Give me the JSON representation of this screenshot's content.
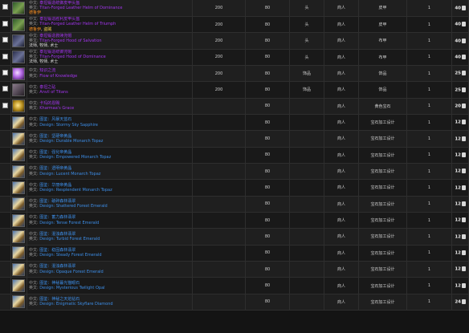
{
  "label_cn": "中文:",
  "label_en": "英文:",
  "items": [
    {
      "icon": "leather-helm-icon",
      "icon_class": "i-leather",
      "checkbox": true,
      "cn": "泰坦锻造统御皮甲头盔",
      "en": "Titan-Forged Leather Helm of Dominance",
      "classes": [
        {
          "text": "德鲁伊",
          "cls": "dk"
        }
      ],
      "ilvl": "200",
      "req": "80",
      "slot": "头",
      "source": "商人",
      "type": "皮甲",
      "qty": "1",
      "price": "40",
      "color": "purple"
    },
    {
      "icon": "leather-helm-icon",
      "icon_class": "i-leather",
      "checkbox": true,
      "cn": "泰坦锻造胜利皮甲头盔",
      "en": "Titan-Forged Leather Helm of Triumph",
      "classes": [
        {
          "text": "德鲁伊",
          "cls": "dk"
        },
        {
          "text": "盗贼",
          "cls": "hn"
        }
      ],
      "ilvl": "200",
      "req": "80",
      "slot": "头",
      "source": "商人",
      "type": "皮甲",
      "qty": "1",
      "price": "40",
      "color": "purple"
    },
    {
      "icon": "cloth-hood-icon",
      "icon_class": "i-cloth",
      "checkbox": true,
      "cn": "泰坦锻造救赎兜帽",
      "en": "Titan-Forged Hood of Salvation",
      "classes": [
        {
          "text": "法师",
          "cls": ""
        },
        {
          "text": "牧师",
          "cls": ""
        },
        {
          "text": "术士",
          "cls": ""
        }
      ],
      "ilvl": "200",
      "req": "80",
      "slot": "头",
      "source": "商人",
      "type": "布甲",
      "qty": "1",
      "price": "40",
      "color": "purple"
    },
    {
      "icon": "cloth-hood-icon",
      "icon_class": "i-cloth",
      "checkbox": true,
      "cn": "泰坦锻造统御兜帽",
      "en": "Titan-Forged Hood of Dominance",
      "classes": [
        {
          "text": "法师",
          "cls": ""
        },
        {
          "text": "牧师",
          "cls": ""
        },
        {
          "text": "术士",
          "cls": ""
        }
      ],
      "ilvl": "200",
      "req": "80",
      "slot": "头",
      "source": "商人",
      "type": "布甲",
      "qty": "1",
      "price": "40",
      "color": "purple"
    },
    {
      "icon": "flow-of-knowledge-icon",
      "icon_class": "i-flow",
      "checkbox": true,
      "cn": "知识之流",
      "en": "Flow of Knowledge",
      "classes": [],
      "ilvl": "200",
      "req": "80",
      "slot": "饰品",
      "source": "商人",
      "type": "饰品",
      "qty": "1",
      "price": "25",
      "color": "purple"
    },
    {
      "icon": "anvil-icon",
      "icon_class": "i-anvil",
      "checkbox": true,
      "cn": "泰坦之砧",
      "en": "Anvil of Titans",
      "classes": [],
      "ilvl": "200",
      "req": "80",
      "slot": "饰品",
      "source": "商人",
      "type": "饰品",
      "qty": "1",
      "price": "25",
      "color": "purple"
    },
    {
      "icon": "yellow-gem-icon",
      "icon_class": "i-gem",
      "checkbox": true,
      "cn": "卡玛的恩赐",
      "en": "Kharmaa's Grace",
      "classes": [],
      "ilvl": "",
      "req": "80",
      "slot": "",
      "source": "商人",
      "type": "黄色宝石",
      "qty": "1",
      "price": "20",
      "color": "purple"
    },
    {
      "icon": "design-scroll-icon",
      "icon_class": "i-design",
      "checkbox": false,
      "cn": "图鉴：风暴天蓝石",
      "en": "Design: Stormy Sky Sapphire",
      "classes": [],
      "ilvl": "",
      "req": "80",
      "slot": "",
      "source": "商人",
      "type": "宝石加工设计",
      "qty": "1",
      "price": "12",
      "color": "blue"
    },
    {
      "icon": "design-scroll-icon",
      "icon_class": "i-design",
      "checkbox": false,
      "cn": "图鉴：坚硬帝黄晶",
      "en": "Design: Durable Monarch Topaz",
      "classes": [],
      "ilvl": "",
      "req": "80",
      "slot": "",
      "source": "商人",
      "type": "宝石加工设计",
      "qty": "1",
      "price": "12",
      "color": "blue"
    },
    {
      "icon": "design-scroll-icon",
      "icon_class": "i-design",
      "checkbox": false,
      "cn": "图鉴：强化帝黄晶",
      "en": "Design: Empowered Monarch Topaz",
      "classes": [],
      "ilvl": "",
      "req": "80",
      "slot": "",
      "source": "商人",
      "type": "宝石加工设计",
      "qty": "1",
      "price": "12",
      "color": "blue"
    },
    {
      "icon": "design-scroll-icon",
      "icon_class": "i-design",
      "checkbox": false,
      "cn": "图鉴：透明帝黄晶",
      "en": "Design: Lucent Monarch Topaz",
      "classes": [],
      "ilvl": "",
      "req": "80",
      "slot": "",
      "source": "商人",
      "type": "宝石加工设计",
      "qty": "1",
      "price": "12",
      "color": "blue"
    },
    {
      "icon": "design-scroll-icon",
      "icon_class": "i-design",
      "checkbox": false,
      "cn": "图鉴：华丽帝黄晶",
      "en": "Design: Resplendent Monarch Topaz",
      "classes": [],
      "ilvl": "",
      "req": "80",
      "slot": "",
      "source": "商人",
      "type": "宝石加工设计",
      "qty": "1",
      "price": "12",
      "color": "blue"
    },
    {
      "icon": "design-scroll-icon",
      "icon_class": "i-design",
      "checkbox": false,
      "cn": "图鉴：破碎森林翡翠",
      "en": "Design: Shattered Forest Emerald",
      "classes": [],
      "ilvl": "",
      "req": "80",
      "slot": "",
      "source": "商人",
      "type": "宝石加工设计",
      "qty": "1",
      "price": "12",
      "color": "blue"
    },
    {
      "icon": "design-scroll-icon",
      "icon_class": "i-design",
      "checkbox": false,
      "cn": "图鉴：蓄力森林翡翠",
      "en": "Design: Tense Forest Emerald",
      "classes": [],
      "ilvl": "",
      "req": "80",
      "slot": "",
      "source": "商人",
      "type": "宝石加工设计",
      "qty": "1",
      "price": "12",
      "color": "blue"
    },
    {
      "icon": "design-scroll-icon",
      "icon_class": "i-design",
      "checkbox": false,
      "cn": "图鉴：混浊森林翡翠",
      "en": "Design: Turbid Forest Emerald",
      "classes": [],
      "ilvl": "",
      "req": "80",
      "slot": "",
      "source": "商人",
      "type": "宝石加工设计",
      "qty": "1",
      "price": "12",
      "color": "blue"
    },
    {
      "icon": "design-scroll-icon",
      "icon_class": "i-design",
      "checkbox": false,
      "cn": "图鉴：稳固森林翡翠",
      "en": "Design: Steady Forest Emerald",
      "classes": [],
      "ilvl": "",
      "req": "80",
      "slot": "",
      "source": "商人",
      "type": "宝石加工设计",
      "qty": "1",
      "price": "12",
      "color": "blue"
    },
    {
      "icon": "design-scroll-icon",
      "icon_class": "i-design",
      "checkbox": false,
      "cn": "图鉴：混浊森林翡翠",
      "en": "Design: Opaque Forest Emerald",
      "classes": [],
      "ilvl": "",
      "req": "80",
      "slot": "",
      "source": "商人",
      "type": "宝石加工设计",
      "qty": "1",
      "price": "12",
      "color": "blue"
    },
    {
      "icon": "design-scroll-icon",
      "icon_class": "i-design",
      "checkbox": false,
      "cn": "图鉴：神秘暮光猫眼石",
      "en": "Design: Mysterious Twilight Opal",
      "classes": [],
      "ilvl": "",
      "req": "80",
      "slot": "",
      "source": "商人",
      "type": "宝石加工设计",
      "qty": "1",
      "price": "12",
      "color": "blue"
    },
    {
      "icon": "design-scroll-icon",
      "icon_class": "i-design",
      "checkbox": false,
      "cn": "图鉴：神秘之天焰钻石",
      "en": "Design: Enigmatic Skyflare Diamond",
      "classes": [],
      "ilvl": "",
      "req": "80",
      "slot": "",
      "source": "商人",
      "type": "宝石加工设计",
      "qty": "1",
      "price": "24",
      "color": "blue"
    }
  ]
}
